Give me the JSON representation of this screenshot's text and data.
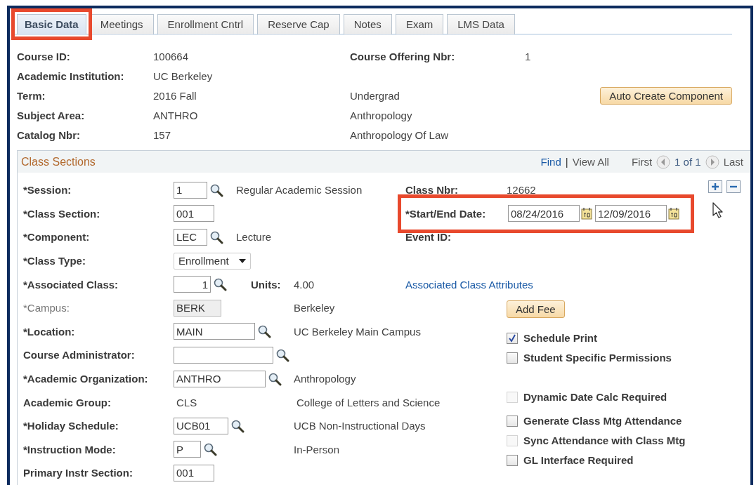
{
  "tabs": [
    {
      "label": "Basic Data",
      "selected": true,
      "highlighted": true
    },
    {
      "label": "Meetings",
      "selected": false,
      "highlighted": false
    },
    {
      "label": "Enrollment Cntrl",
      "selected": false,
      "highlighted": false
    },
    {
      "label": "Reserve Cap",
      "selected": false,
      "highlighted": false
    },
    {
      "label": "Notes",
      "selected": false,
      "highlighted": false
    },
    {
      "label": "Exam",
      "selected": false,
      "highlighted": false
    },
    {
      "label": "LMS Data",
      "selected": false,
      "highlighted": false
    }
  ],
  "course": {
    "fields": [
      {
        "label": "Course ID:",
        "value": "100664"
      },
      {
        "label": "Academic Institution:",
        "value": "UC Berkeley"
      },
      {
        "label": "Term:",
        "value": "2016 Fall"
      },
      {
        "label": "Subject Area:",
        "value": "ANTHRO"
      },
      {
        "label": "Catalog Nbr:",
        "value": "157"
      }
    ],
    "offering": {
      "label": "Course Offering Nbr:",
      "value": "1"
    },
    "descriptions": [
      "Undergrad",
      "Anthropology",
      "Anthropology Of Law"
    ],
    "button": "Auto Create Component"
  },
  "class_sections": {
    "title": "Class Sections",
    "nav": {
      "find": "Find",
      "separator": "|",
      "view_all": "View All",
      "first": "First",
      "count": "1 of 1",
      "last": "Last"
    },
    "rows": [
      {
        "label": "*Session:",
        "kind": "input",
        "value": "1",
        "lookup": true,
        "disabled": false,
        "desc": "Regular Academic Session"
      },
      {
        "label": "*Class Section:",
        "kind": "input",
        "value": "001",
        "lookup": false,
        "disabled": false
      },
      {
        "label": "*Component:",
        "kind": "input",
        "value": "LEC",
        "lookup": true,
        "disabled": false,
        "desc": "Lecture"
      },
      {
        "label": "*Class Type:",
        "kind": "select",
        "value": "Enrollment",
        "disabled": false
      },
      {
        "label": "*Associated Class:",
        "kind": "input",
        "value": "1",
        "lookup": true,
        "disabled": false,
        "extra_label": "Units:",
        "desc": "4.00"
      },
      {
        "label": "*Campus:",
        "kind": "input",
        "value": "BERK",
        "lookup": false,
        "disabled": true,
        "desc": "Berkeley"
      },
      {
        "label": "*Location:",
        "kind": "input",
        "value": "MAIN",
        "lookup": true,
        "disabled": false,
        "desc": "UC Berkeley Main Campus"
      },
      {
        "label": "Course Administrator:",
        "kind": "input",
        "lookup": true,
        "disabled": false
      },
      {
        "label": "*Academic Organization:",
        "kind": "input",
        "value": "ANTHRO",
        "lookup": true,
        "disabled": false,
        "desc": "Anthropology"
      },
      {
        "label": "Academic Group:",
        "kind": "text",
        "value": "CLS",
        "disabled": false,
        "desc": "College of Letters and Science"
      },
      {
        "label": "*Holiday Schedule:",
        "kind": "input",
        "value": "UCB01",
        "lookup": true,
        "disabled": false,
        "desc": "UCB Non-Instructional Days"
      },
      {
        "label": "*Instruction Mode:",
        "kind": "input",
        "value": "P",
        "lookup": true,
        "disabled": false,
        "desc": "In-Person"
      },
      {
        "label": "Primary Instr Section:",
        "kind": "input",
        "value": "001",
        "lookup": false,
        "disabled": false
      }
    ],
    "class_nbr": {
      "label": "Class Nbr:",
      "value": "12662"
    },
    "dates": {
      "label": "*Start/End Date:",
      "start": "08/24/2016",
      "end": "12/09/2016",
      "highlighted": true
    },
    "event_id": {
      "label": "Event ID:"
    },
    "attributes_link": "Associated Class Attributes",
    "fee_button": "Add Fee",
    "checkboxes": [
      {
        "label": "Schedule Print",
        "checked": true,
        "disabled": false
      },
      {
        "label": "Student Specific Permissions",
        "checked": false,
        "disabled": false
      },
      {
        "label": "Dynamic Date Calc Required",
        "checked": false,
        "disabled": true
      },
      {
        "label": "Generate Class Mtg Attendance",
        "checked": false,
        "disabled": false
      },
      {
        "label": "Sync Attendance with Class Mtg",
        "checked": false,
        "disabled": true
      },
      {
        "label": "GL Interface Required",
        "checked": false,
        "disabled": false
      }
    ]
  }
}
